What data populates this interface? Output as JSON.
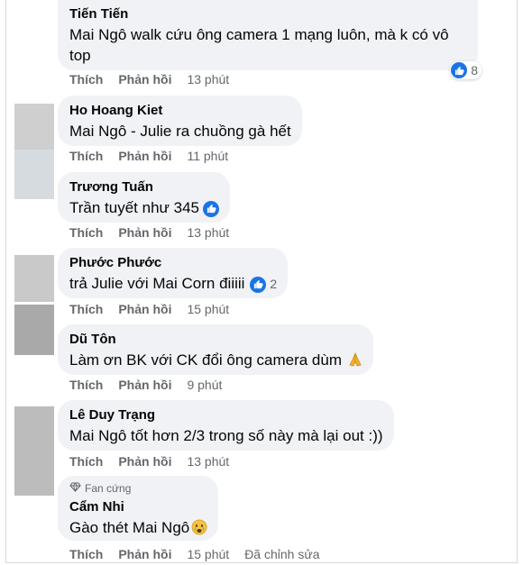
{
  "action_like": "Thích",
  "action_reply": "Phản hồi",
  "comments": [
    {
      "name": "Tiến Tiến",
      "text_line1": "Mai Ngô walk cứu ông camera 1 mạng luôn, mà k có vô",
      "text_line2": "top",
      "time": "13 phút",
      "reactions": "8"
    },
    {
      "name": "Ho Hoang Kiet",
      "text": "Mai Ngô - Julie ra chuồng gà hết",
      "time": "11 phút"
    },
    {
      "name": "Trương Tuấn",
      "text": "Trần tuyết như 345",
      "time": "13 phút"
    },
    {
      "name": "Phước Phước",
      "text": "trả Julie với Mai Corn điiiii",
      "time": "15 phút",
      "reactions": "2"
    },
    {
      "name": "Dũ Tôn",
      "text": "Làm ơn BK với CK đổi ông camera dùm",
      "time": "9 phút"
    },
    {
      "name": "Lê Duy Trạng",
      "text": "Mai Ngô tốt hơn 2/3 trong số này mà lại out :))",
      "time": "13 phút"
    },
    {
      "name": "Cẩm Nhi",
      "badge": "Fan cứng",
      "text": "Gào thét Mai Ngô",
      "time": "15 phút",
      "edited": "Đã chỉnh sửa"
    }
  ],
  "colors": {
    "bubble": "#f0f2f5",
    "like_blue": "#1b74e4",
    "meta_gray": "#65676b"
  }
}
